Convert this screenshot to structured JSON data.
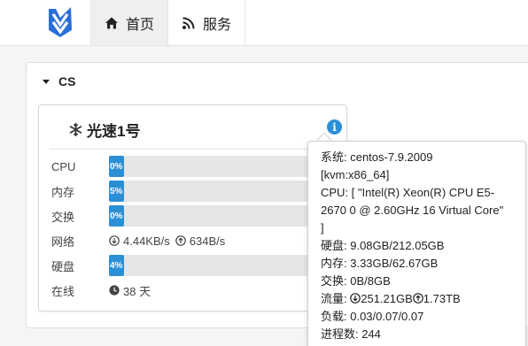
{
  "nav": {
    "home_label": "首页",
    "service_label": "服务"
  },
  "panel": {
    "title": "CS"
  },
  "server": {
    "name": "光速1号",
    "info_glyph": "i",
    "rows": {
      "cpu_label": "CPU",
      "cpu_percent": "0%",
      "cpu_value": 0,
      "mem_label": "内存",
      "mem_percent": "5%",
      "mem_value": 5,
      "swap_label": "交换",
      "swap_percent": "0%",
      "swap_value": 0,
      "net_label": "网络",
      "net_down": "4.44KB/s",
      "net_up": "634B/s",
      "disk_label": "硬盘",
      "disk_percent": "4%",
      "disk_value": 4,
      "uptime_label": "在线",
      "uptime_value": "38 天"
    }
  },
  "popup": {
    "system": "系统: centos-7.9.2009",
    "arch": "[kvm:x86_64]",
    "cpu_line1": "CPU: [ \"Intel(R) Xeon(R) CPU E5-",
    "cpu_line2": "2670 0 @ 2.60GHz 16 Virtual Core\"",
    "cpu_line3": "]",
    "disk": "硬盘: 9.08GB/212.05GB",
    "mem": "内存: 3.33GB/62.67GB",
    "swap": "交换: 0B/8GB",
    "traffic_label": "流量: ",
    "traffic_down": "251.21GB",
    "traffic_up": "1.73TB",
    "load": "负载: 0.03/0.07/0.07",
    "procs": "进程数: 244"
  },
  "colors": {
    "accent": "#2b8fd6",
    "logo": "#2a6fd8"
  }
}
